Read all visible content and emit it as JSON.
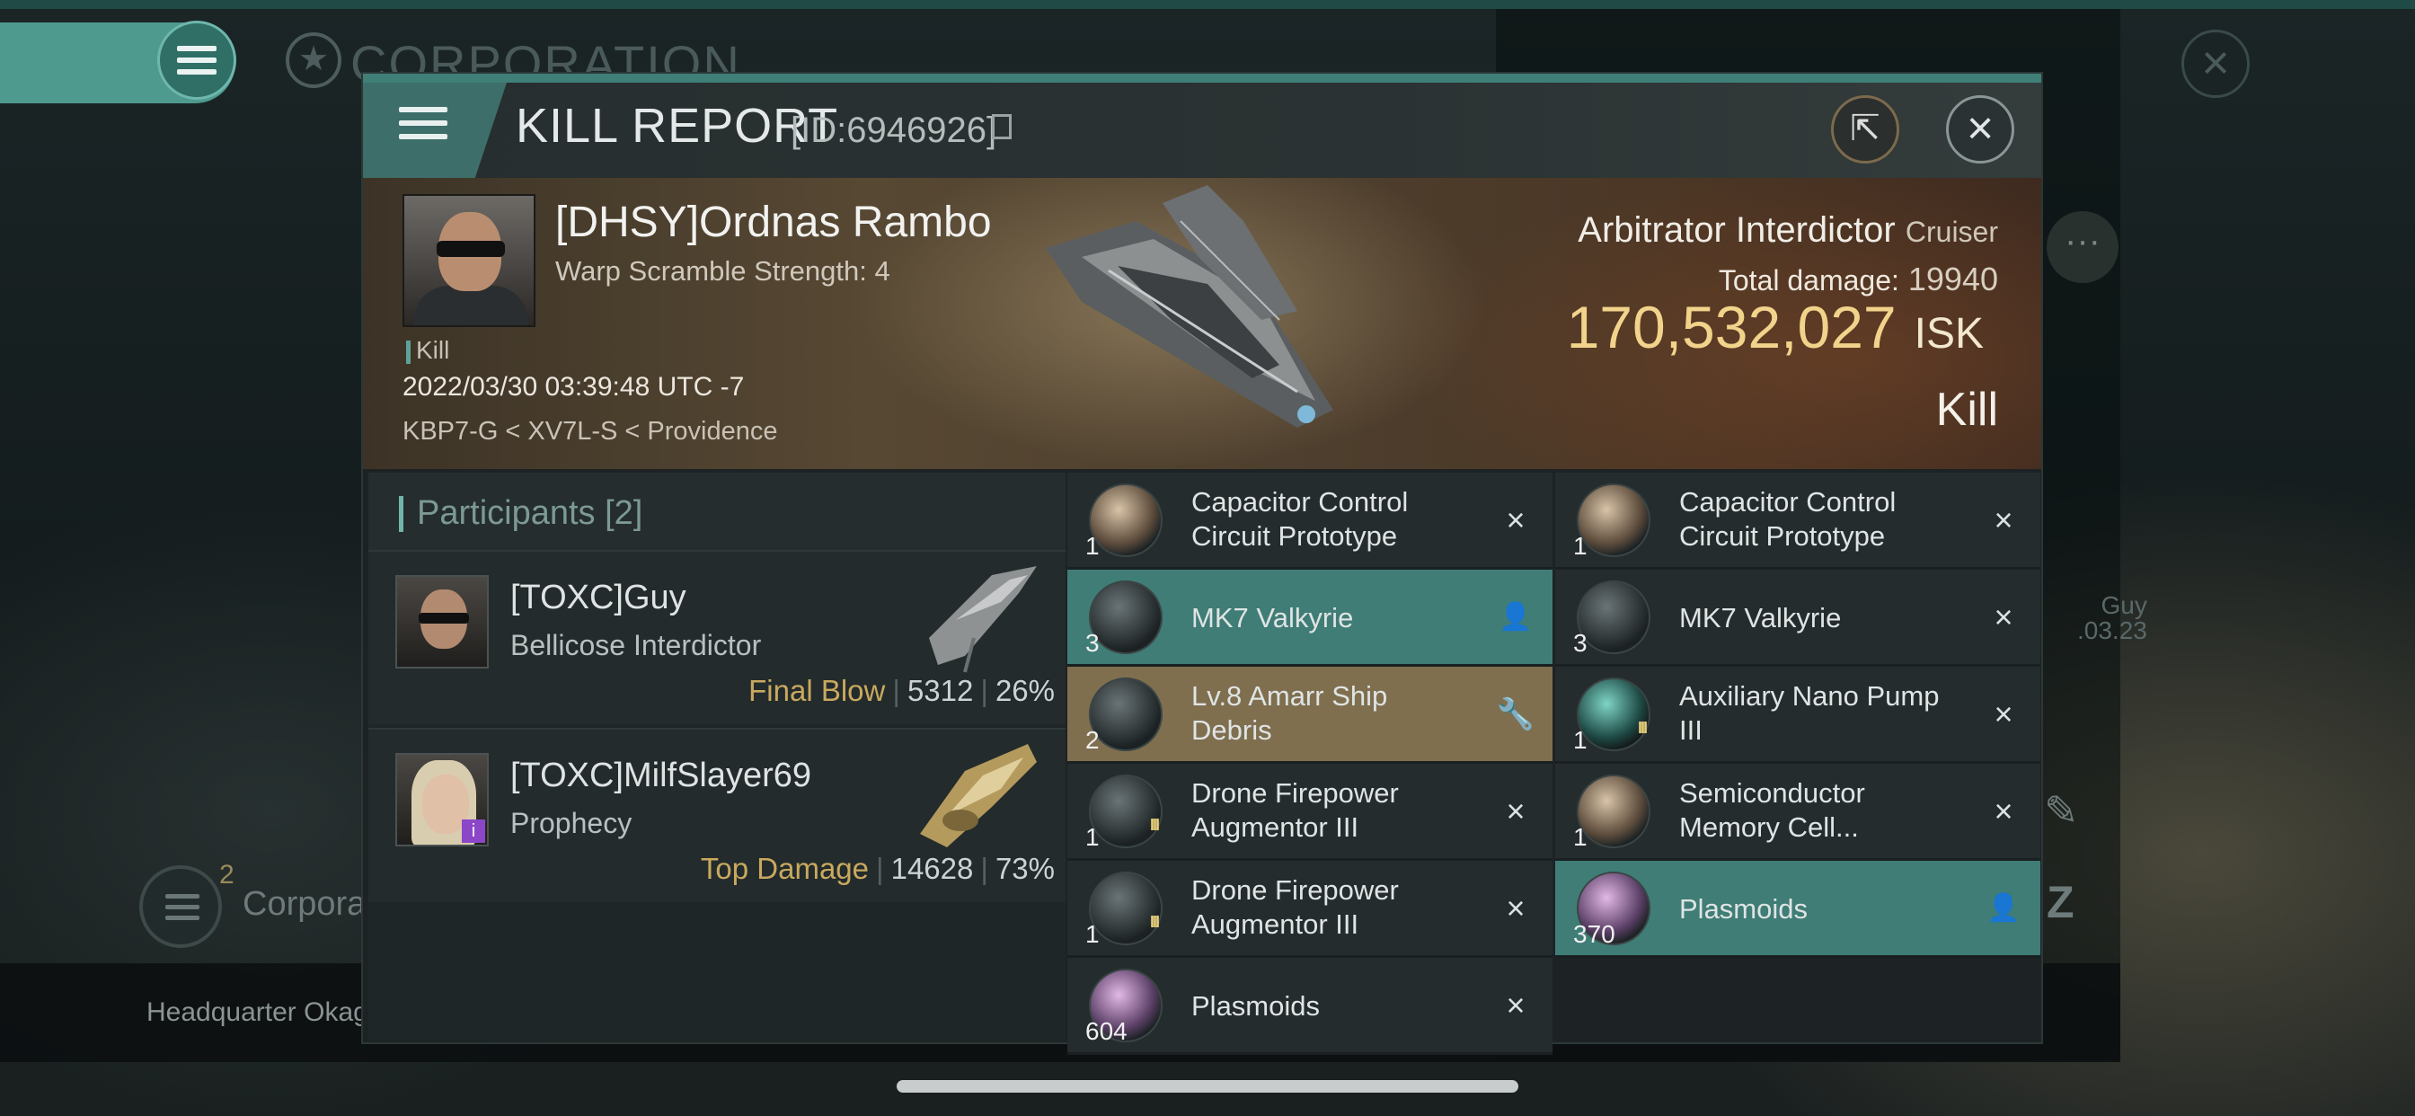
{
  "background": {
    "corp_title": "CORPORATION",
    "headquarter_text": "Headquarter Okag",
    "corp_bottom_label": "Corpora",
    "corp_bottom_count": "2",
    "side_name": "Guy",
    "side_date": ".03.23"
  },
  "window": {
    "title": "KILL REPORT",
    "id_text": "[ID:6946926]"
  },
  "victim": {
    "name": "[DHSY]Ordnas Rambo",
    "subtitle": "Warp Scramble Strength: 4",
    "tag": "Kill",
    "datetime": "2022/03/30 03:39:48 UTC -7",
    "location": "KBP7-G < XV7L-S < Providence",
    "ship_name": "Arbitrator Interdictor",
    "ship_class": "Cruiser",
    "total_damage_label": "Total damage:",
    "total_damage": "19940",
    "isk_value": "170,532,027",
    "isk_unit": "ISK",
    "result": "Kill"
  },
  "participants": {
    "header": "Participants [2]",
    "items": [
      {
        "name": "[TOXC]Guy",
        "ship": "Bellicose Interdictor",
        "role": "Final Blow",
        "damage": "5312",
        "percent": "26%"
      },
      {
        "name": "[TOXC]MilfSlayer69",
        "ship": "Prophecy",
        "role": "Top Damage",
        "damage": "14628",
        "percent": "73%"
      }
    ]
  },
  "items_left": [
    {
      "qty": "1",
      "line1": "Capacitor Control",
      "line2": "Circuit Prototype",
      "state": "destroyed",
      "icon": "capacitor-icon"
    },
    {
      "qty": "3",
      "line1": "MK7  Valkyrie",
      "line2": "",
      "state": "dropped",
      "icon": "drone-icon"
    },
    {
      "qty": "2",
      "line1": "Lv.8 Amarr Ship",
      "line2": "Debris",
      "state": "salvage",
      "icon": "debris-icon"
    },
    {
      "qty": "1",
      "line1": "Drone Firepower",
      "line2": "Augmentor III",
      "state": "destroyed",
      "icon": "drone-augmentor-icon",
      "tier": "III"
    },
    {
      "qty": "1",
      "line1": "Drone Firepower",
      "line2": "Augmentor III",
      "state": "destroyed",
      "icon": "drone-augmentor-icon",
      "tier": "III"
    },
    {
      "qty": "604",
      "line1": "Plasmoids",
      "line2": "",
      "state": "destroyed",
      "icon": "plasmoid-icon"
    }
  ],
  "items_right": [
    {
      "qty": "1",
      "line1": "Capacitor Control",
      "line2": "Circuit Prototype",
      "state": "destroyed",
      "icon": "capacitor-icon"
    },
    {
      "qty": "3",
      "line1": "MK7  Valkyrie",
      "line2": "",
      "state": "destroyed",
      "icon": "drone-icon"
    },
    {
      "qty": "1",
      "line1": "Auxiliary Nano Pump",
      "line2": "III",
      "state": "destroyed",
      "icon": "nano-pump-icon",
      "tier": "III"
    },
    {
      "qty": "1",
      "line1": "Semiconductor",
      "line2": "Memory Cell...",
      "state": "destroyed",
      "icon": "memory-cell-icon"
    },
    {
      "qty": "370",
      "line1": "Plasmoids",
      "line2": "",
      "state": "dropped",
      "icon": "plasmoid-icon"
    }
  ],
  "colors": {
    "accent_teal": "#3f7d76",
    "salvage_gold": "#7f6f4f",
    "isk_gold": "#f2d38b"
  }
}
